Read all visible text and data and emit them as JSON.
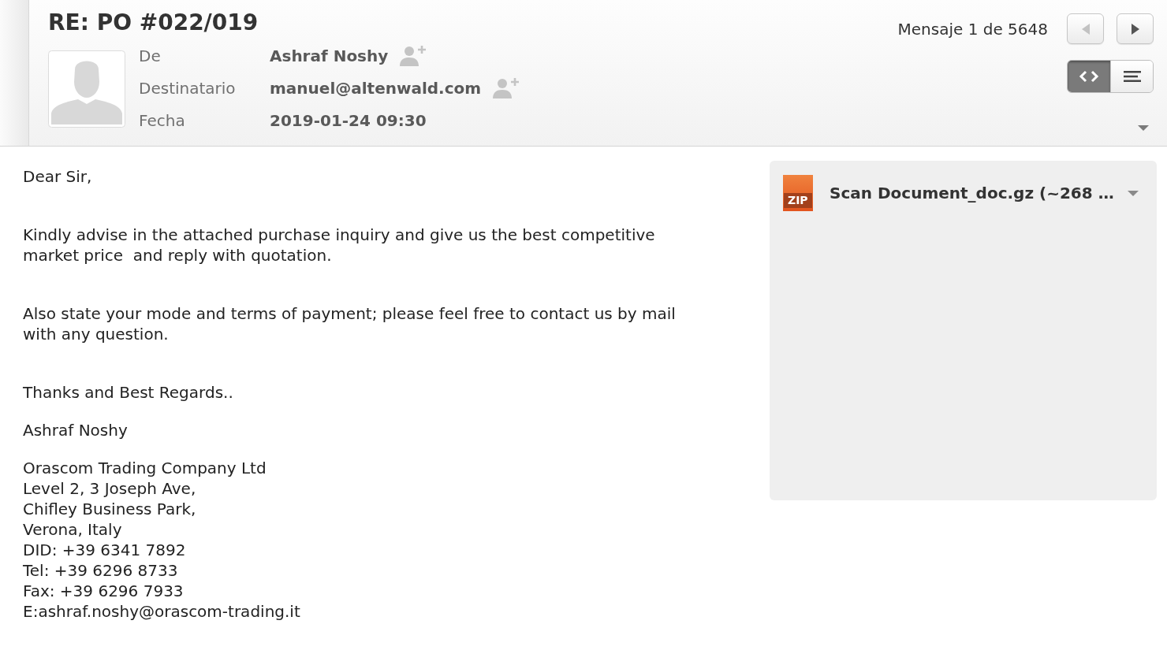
{
  "header": {
    "subject": "RE: PO #022/019",
    "fields": [
      {
        "label": "De",
        "value": "Ashraf Noshy",
        "add_contact": true
      },
      {
        "label": "Destinatario",
        "value": "manuel@altenwald.com",
        "add_contact": true
      },
      {
        "label": "Fecha",
        "value": "2019-01-24 09:30",
        "add_contact": false
      }
    ],
    "counter": "Mensaje 1 de 5648",
    "nav_buttons": [
      {
        "kind": "previous",
        "disabled": true
      },
      {
        "kind": "next",
        "disabled": false
      }
    ],
    "view_toggle": [
      {
        "kind": "html",
        "selected": true
      },
      {
        "kind": "plain",
        "selected": false
      }
    ]
  },
  "body": {
    "paragraphs": [
      "Dear Sir,",
      "Kindly advise in the attached purchase inquiry and give us the best competitive market price  and reply with quotation.",
      "Also state your mode and terms of payment; please feel free to contact us by mail with any question."
    ],
    "signature": {
      "closing": "Thanks and Best Regards..",
      "name": "Ashraf Noshy",
      "lines": [
        "Orascom Trading Company Ltd",
        "Level 2, 3 Joseph Ave,",
        "Chifley Business Park,",
        "Verona, Italy",
        "DID: +39 6341 7892",
        "Tel: +39 6296 8733",
        "Fax: +39 6296 7933",
        "E:ashraf.noshy@orascom-trading.it"
      ]
    }
  },
  "attachments": [
    {
      "type_label": "ZIP",
      "name": "Scan Document_doc.gz (~268 …"
    }
  ]
}
